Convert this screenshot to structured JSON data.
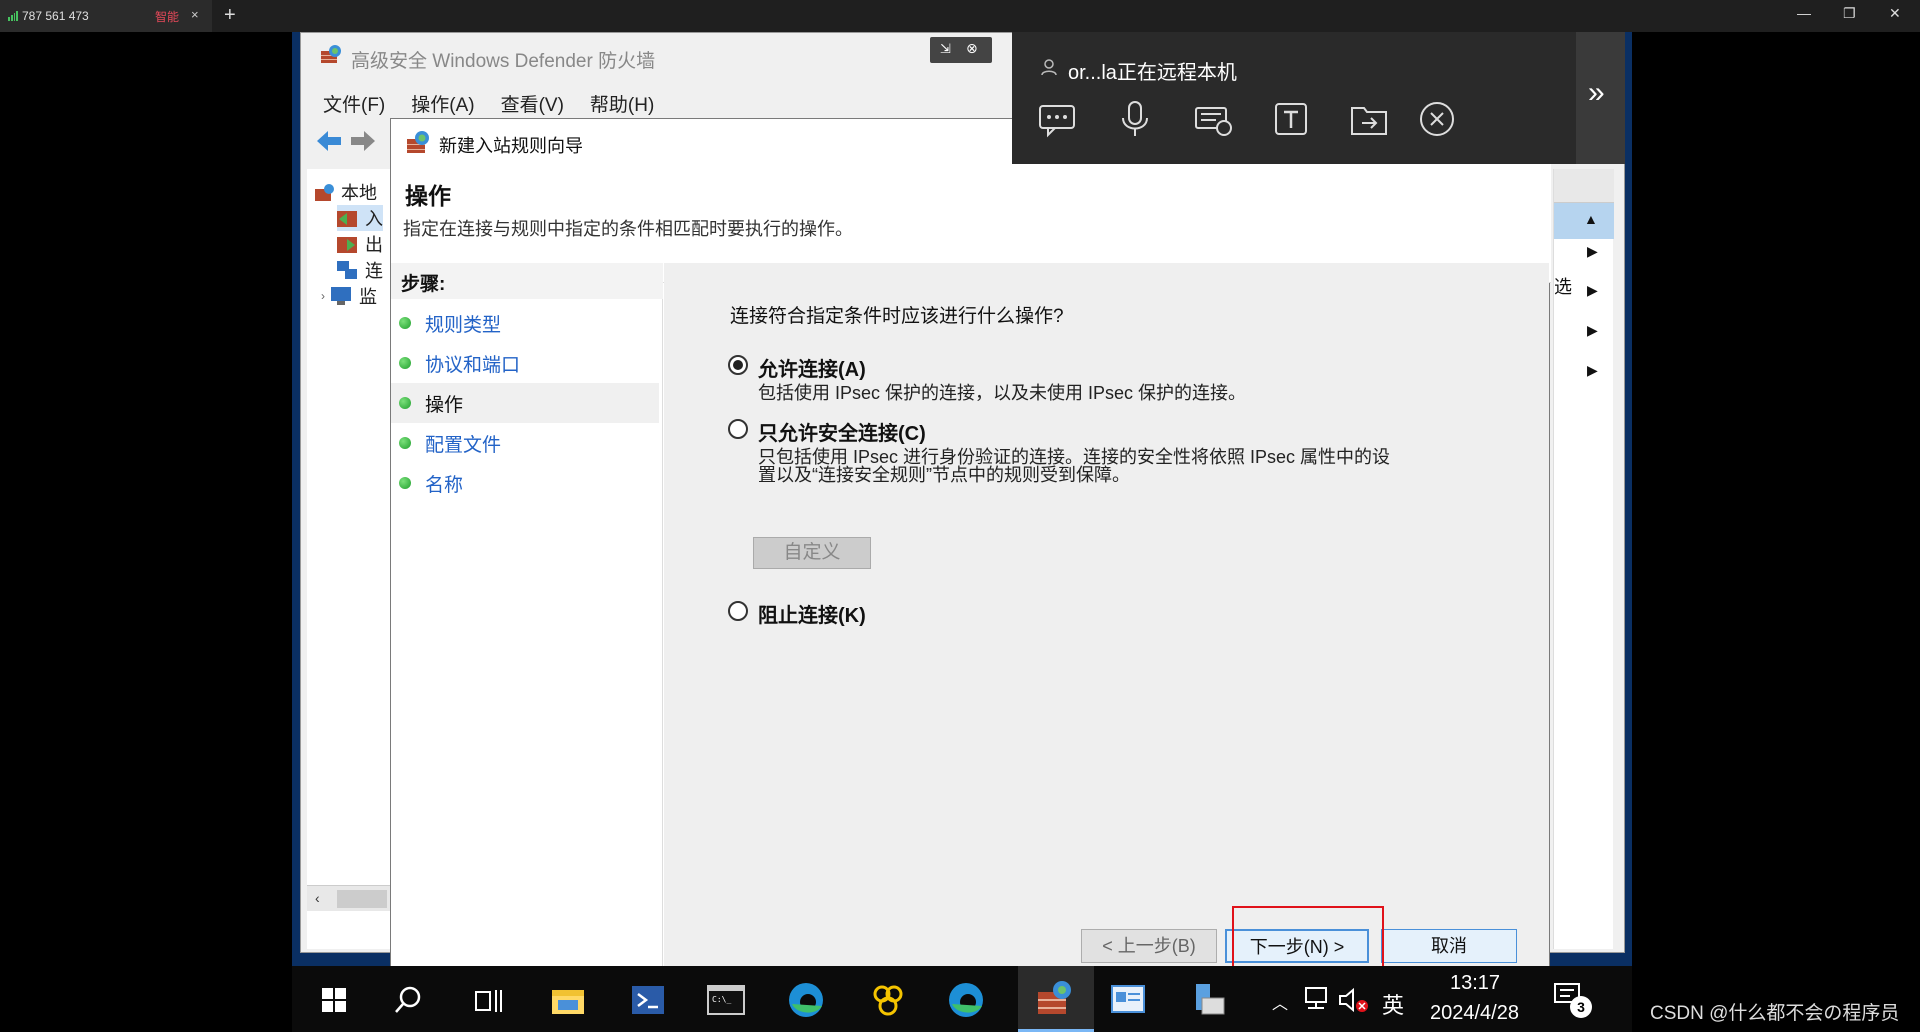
{
  "client": {
    "connection_id": "787 561 473",
    "mode_label": "智能",
    "tab_close": "×",
    "add_tab": "+",
    "window_controls": {
      "minimize": "—",
      "restore": "❐",
      "close": "✕"
    }
  },
  "mmc": {
    "title": "高级安全 Windows Defender 防火墙",
    "menu": [
      "文件(F)",
      "操作(A)",
      "查看(V)",
      "帮助(H)"
    ],
    "tree": [
      "本地",
      "入",
      "出",
      "连",
      "监"
    ],
    "actions_partial": "选"
  },
  "wizard": {
    "title": "新建入站规则向导",
    "heading": "操作",
    "subtitle": "指定在连接与规则中指定的条件相匹配时要执行的操作。",
    "steps_label": "步骤:",
    "steps": [
      {
        "label": "规则类型",
        "active": false
      },
      {
        "label": "协议和端口",
        "active": false
      },
      {
        "label": "操作",
        "active": true
      },
      {
        "label": "配置文件",
        "active": false
      },
      {
        "label": "名称",
        "active": false
      }
    ],
    "question": "连接符合指定条件时应该进行什么操作?",
    "options": [
      {
        "label": "允许连接(A)",
        "desc": "包括使用 IPsec 保护的连接，以及未使用 IPsec 保护的连接。",
        "selected": true
      },
      {
        "label": "只允许安全连接(C)",
        "desc1": "只包括使用 IPsec 进行身份验证的连接。连接的安全性将依照 IPsec 属性中的设",
        "desc2": "置以及“连接安全规则”节点中的规则受到保障。",
        "selected": false
      },
      {
        "label": "阻止连接(K)",
        "selected": false
      }
    ],
    "customize": "自定义",
    "buttons": {
      "back": "< 上一步(B)",
      "next": "下一步(N) >",
      "cancel": "取消"
    }
  },
  "remote_panel": {
    "status": "or...la正在远程本机",
    "expand": "»"
  },
  "taskbar": {
    "time": "13:17",
    "date": "2024/4/28",
    "language": "英",
    "notifications": "3"
  },
  "watermark": "CSDN @什么都不会の程序员",
  "colors": {
    "accent": "#2363c7",
    "highlight": "#e0121a",
    "panel": "#2a2a2a"
  }
}
